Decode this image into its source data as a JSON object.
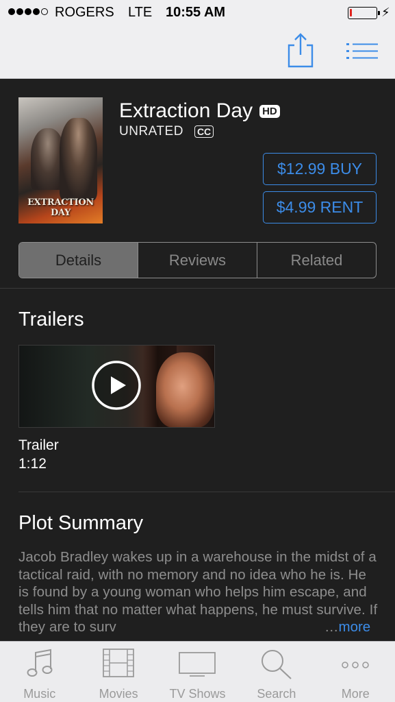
{
  "status_bar": {
    "carrier": "ROGERS",
    "network": "LTE",
    "time": "10:55 AM",
    "signal_bars": 4,
    "signal_total": 5,
    "battery_level": 0.08
  },
  "nav": {
    "share_icon": "share-icon",
    "list_icon": "list-icon",
    "accent_color": "#3c8ce8"
  },
  "movie": {
    "title": "Extraction Day",
    "hd_badge": "HD",
    "rating": "UNRATED",
    "cc_badge": "CC",
    "poster_title": "EXTRACTION DAY",
    "buy_label": "$12.99 BUY",
    "rent_label": "$4.99 RENT"
  },
  "segments": {
    "items": [
      "Details",
      "Reviews",
      "Related"
    ],
    "selected": "Details"
  },
  "trailers": {
    "heading": "Trailers",
    "items": [
      {
        "label": "Trailer",
        "duration": "1:12"
      }
    ]
  },
  "plot": {
    "heading": "Plot Summary",
    "text": "Jacob Bradley wakes up in a warehouse in the midst of a tactical raid, with no memory and no idea who he is. He is found by a young woman who helps him escape, and tells him that no matter what happens, he must survive. If they are to surv",
    "ellipsis": "…",
    "more_label": "more"
  },
  "tabbar": {
    "items": [
      {
        "label": "Music",
        "icon": "music-note-icon"
      },
      {
        "label": "Movies",
        "icon": "film-icon"
      },
      {
        "label": "TV Shows",
        "icon": "tv-icon"
      },
      {
        "label": "Search",
        "icon": "search-icon"
      },
      {
        "label": "More",
        "icon": "more-dots-icon"
      }
    ]
  }
}
